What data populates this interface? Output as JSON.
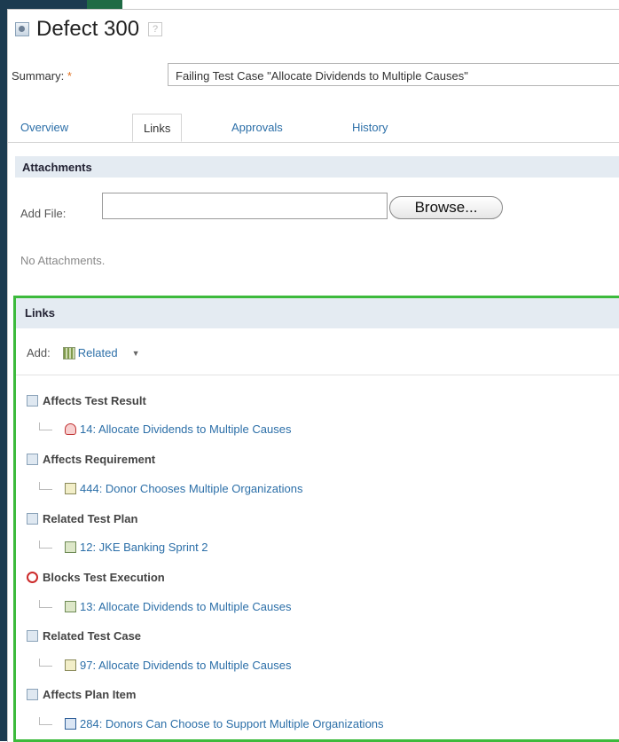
{
  "header": {
    "title": "Defect 300",
    "help": "?"
  },
  "summary": {
    "label": "Summary:",
    "required_mark": "*",
    "value": "Failing Test Case \"Allocate Dividends to Multiple Causes\""
  },
  "tabs": [
    {
      "label": "Overview"
    },
    {
      "label": "Links"
    },
    {
      "label": "Approvals"
    },
    {
      "label": "History"
    }
  ],
  "active_tab": "Links",
  "attachments": {
    "header": "Attachments",
    "add_file_label": "Add File:",
    "browse_label": "Browse...",
    "empty_text": "No Attachments."
  },
  "links": {
    "header": "Links",
    "add_label": "Add:",
    "add_type": "Related",
    "groups": [
      {
        "title": "Affects Test Result",
        "icon": "test-result-icon",
        "items": [
          {
            "text": "14: Allocate Dividends to Multiple Causes",
            "icon": "failed-result-icon"
          }
        ]
      },
      {
        "title": "Affects Requirement",
        "icon": "requirement-icon",
        "items": [
          {
            "text": "444: Donor Chooses Multiple Organizations",
            "icon": "requirement-item-icon"
          }
        ]
      },
      {
        "title": "Related Test Plan",
        "icon": "test-plan-icon",
        "items": [
          {
            "text": "12: JKE Banking Sprint 2",
            "icon": "plan-item-icon"
          }
        ]
      },
      {
        "title": "Blocks Test Execution",
        "icon": "blocks-icon",
        "items": [
          {
            "text": "13: Allocate Dividends to Multiple Causes",
            "icon": "execution-item-icon"
          }
        ]
      },
      {
        "title": "Related Test Case",
        "icon": "test-case-icon",
        "items": [
          {
            "text": "97: Allocate Dividends to Multiple Causes",
            "icon": "test-case-item-icon"
          }
        ]
      },
      {
        "title": "Affects Plan Item",
        "icon": "plan-item-group-icon",
        "items": [
          {
            "text": "284: Donors Can Choose to Support Multiple Organizations",
            "icon": "story-icon"
          }
        ]
      }
    ]
  },
  "colors": {
    "link": "#2c6fa8",
    "panel_highlight": "#3cba3c",
    "section_bg": "#e4ebf2",
    "required": "#e07020"
  }
}
